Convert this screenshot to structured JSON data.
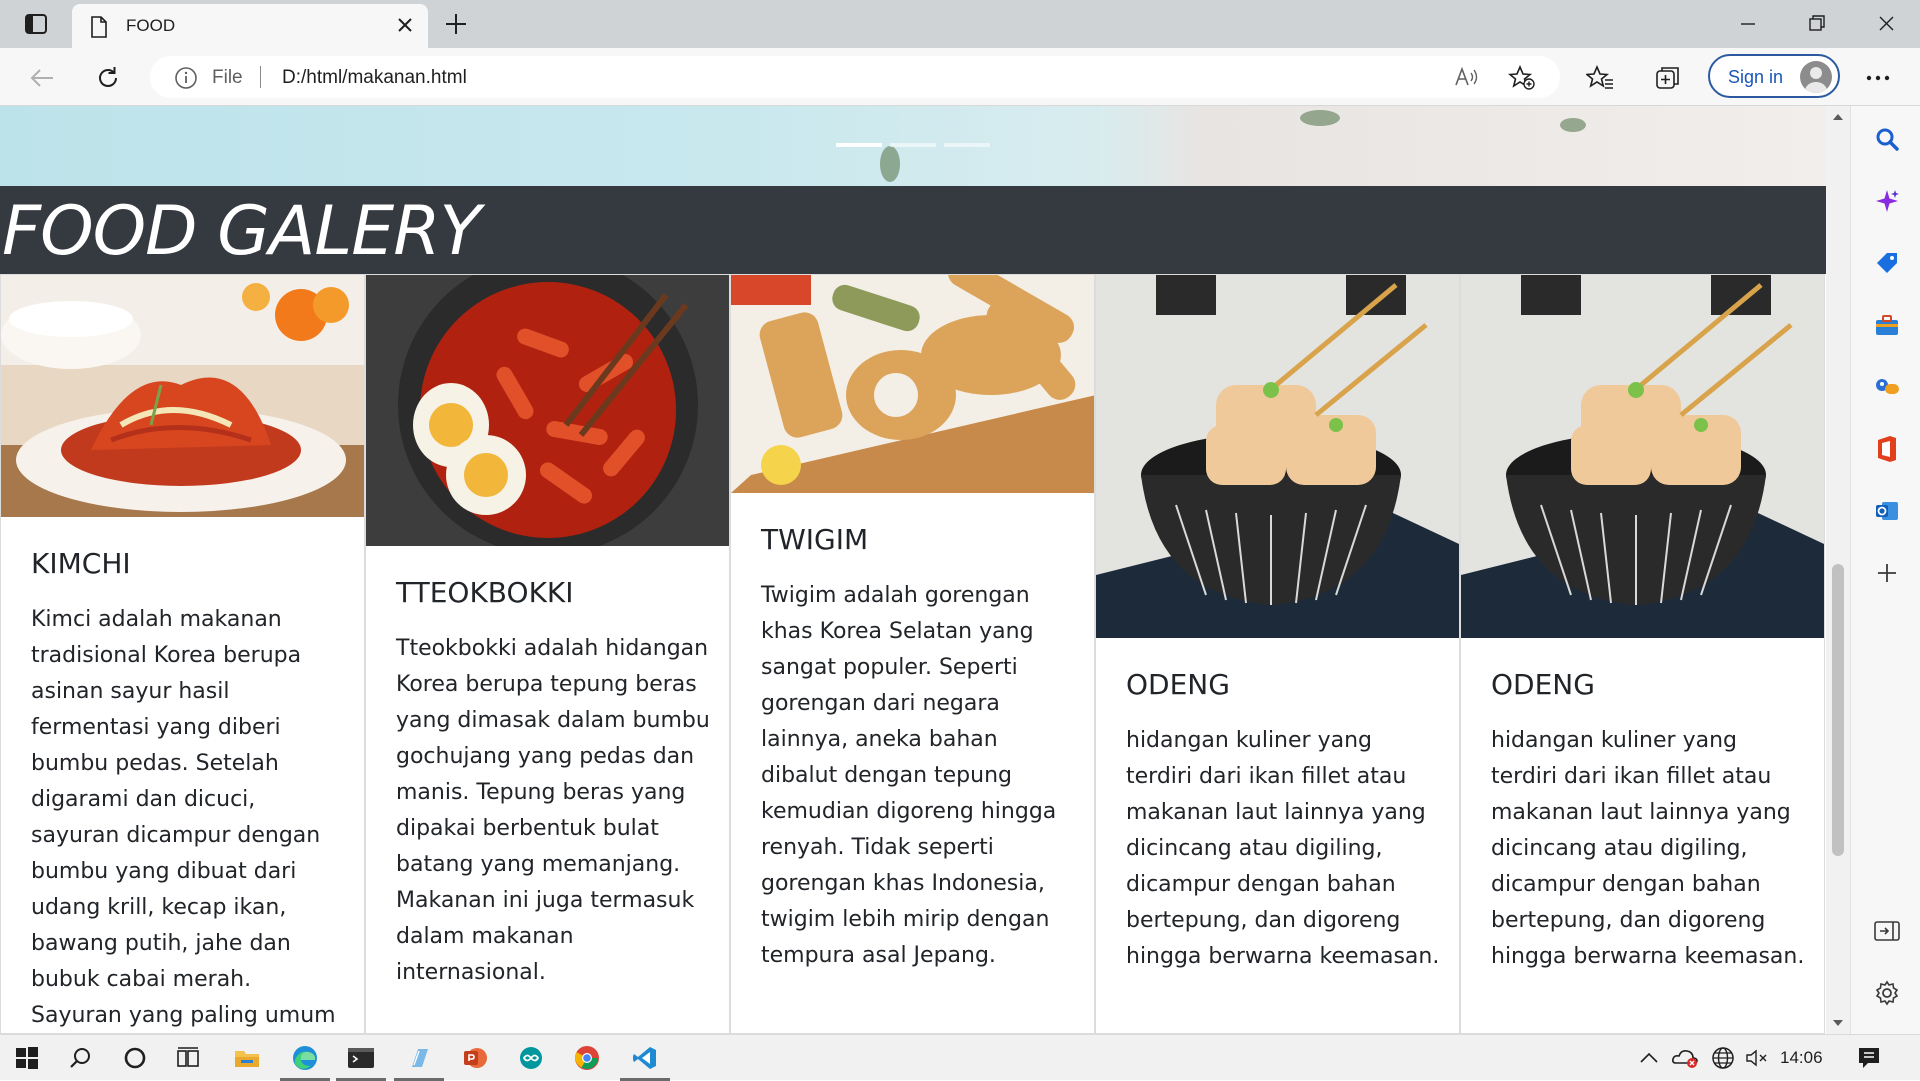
{
  "browser": {
    "tab_title": "FOOD",
    "address": {
      "scheme": "File",
      "url": "D:/html/makanan.html"
    },
    "signin_label": "Sign in"
  },
  "page": {
    "gallery_title": "FOOD GALERY",
    "carousel": {
      "slide_count": 3,
      "active_index": 0
    },
    "cards": [
      {
        "title": "KIMCHI",
        "image": "kimchi-photo",
        "text": "Kimci adalah makanan tradisional Korea berupa asinan sayur hasil fermentasi yang diberi bumbu pedas. Setelah digarami dan dicuci, sayuran dicampur dengan bumbu yang dibuat dari udang krill, kecap ikan, bawang putih, jahe dan bubuk cabai merah. Sayuran yang paling umum dibuat kimci adalah"
      },
      {
        "title": "TTEOKBOKKI",
        "image": "tteokbokki-photo",
        "text": "Tteokbokki adalah hidangan Korea berupa tepung beras yang dimasak dalam bumbu gochujang yang pedas dan manis. Tepung beras yang dipakai berbentuk bulat batang yang memanjang. Makanan ini juga termasuk dalam makanan internasional."
      },
      {
        "title": "TWIGIM",
        "image": "twigim-photo",
        "text": "Twigim adalah gorengan khas Korea Selatan yang sangat populer. Seperti gorengan dari negara lainnya, aneka bahan dibalut dengan tepung kemudian digoreng hingga renyah. Tidak seperti gorengan khas Indonesia, twigim lebih mirip dengan tempura asal Jepang."
      },
      {
        "title": "ODENG",
        "image": "odeng-photo",
        "text": "hidangan kuliner yang terdiri dari ikan fillet atau makanan laut lainnya yang dicincang atau digiling, dicampur dengan bahan bertepung, dan digoreng hingga berwarna keemasan."
      },
      {
        "title": "ODENG",
        "image": "odeng-photo",
        "text": "hidangan kuliner yang terdiri dari ikan fillet atau makanan laut lainnya yang dicincang atau digiling, dicampur dengan bahan bertepung, dan digoreng hingga berwarna keemasan."
      }
    ]
  },
  "taskbar": {
    "time": "14:06"
  },
  "colors": {
    "gallery_bar": "#343a40",
    "signin_border": "#2b5aa0",
    "signin_text": "#1a56b8"
  }
}
